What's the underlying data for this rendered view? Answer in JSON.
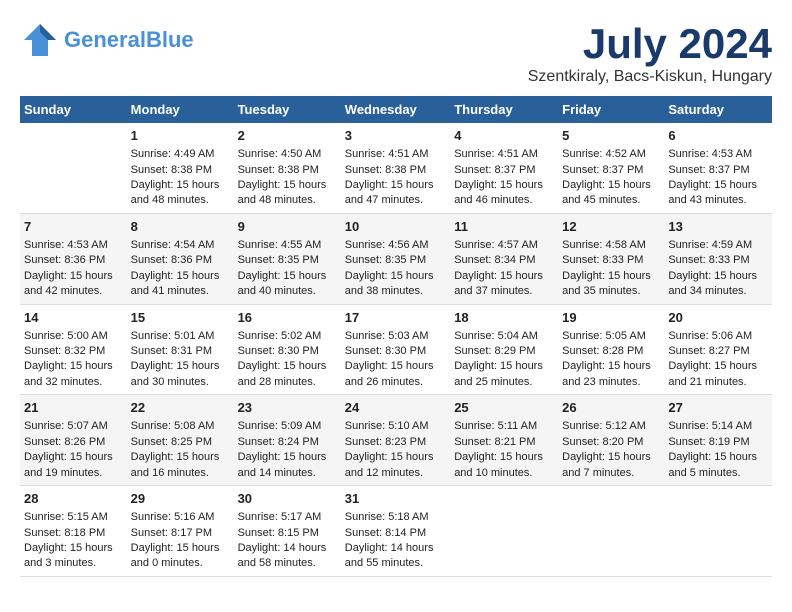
{
  "header": {
    "logo_line1": "General",
    "logo_line2": "Blue",
    "month_title": "July 2024",
    "location": "Szentkiraly, Bacs-Kiskun, Hungary"
  },
  "weekdays": [
    "Sunday",
    "Monday",
    "Tuesday",
    "Wednesday",
    "Thursday",
    "Friday",
    "Saturday"
  ],
  "weeks": [
    [
      {
        "day": "",
        "info": ""
      },
      {
        "day": "1",
        "info": "Sunrise: 4:49 AM\nSunset: 8:38 PM\nDaylight: 15 hours\nand 48 minutes."
      },
      {
        "day": "2",
        "info": "Sunrise: 4:50 AM\nSunset: 8:38 PM\nDaylight: 15 hours\nand 48 minutes."
      },
      {
        "day": "3",
        "info": "Sunrise: 4:51 AM\nSunset: 8:38 PM\nDaylight: 15 hours\nand 47 minutes."
      },
      {
        "day": "4",
        "info": "Sunrise: 4:51 AM\nSunset: 8:37 PM\nDaylight: 15 hours\nand 46 minutes."
      },
      {
        "day": "5",
        "info": "Sunrise: 4:52 AM\nSunset: 8:37 PM\nDaylight: 15 hours\nand 45 minutes."
      },
      {
        "day": "6",
        "info": "Sunrise: 4:53 AM\nSunset: 8:37 PM\nDaylight: 15 hours\nand 43 minutes."
      }
    ],
    [
      {
        "day": "7",
        "info": "Sunrise: 4:53 AM\nSunset: 8:36 PM\nDaylight: 15 hours\nand 42 minutes."
      },
      {
        "day": "8",
        "info": "Sunrise: 4:54 AM\nSunset: 8:36 PM\nDaylight: 15 hours\nand 41 minutes."
      },
      {
        "day": "9",
        "info": "Sunrise: 4:55 AM\nSunset: 8:35 PM\nDaylight: 15 hours\nand 40 minutes."
      },
      {
        "day": "10",
        "info": "Sunrise: 4:56 AM\nSunset: 8:35 PM\nDaylight: 15 hours\nand 38 minutes."
      },
      {
        "day": "11",
        "info": "Sunrise: 4:57 AM\nSunset: 8:34 PM\nDaylight: 15 hours\nand 37 minutes."
      },
      {
        "day": "12",
        "info": "Sunrise: 4:58 AM\nSunset: 8:33 PM\nDaylight: 15 hours\nand 35 minutes."
      },
      {
        "day": "13",
        "info": "Sunrise: 4:59 AM\nSunset: 8:33 PM\nDaylight: 15 hours\nand 34 minutes."
      }
    ],
    [
      {
        "day": "14",
        "info": "Sunrise: 5:00 AM\nSunset: 8:32 PM\nDaylight: 15 hours\nand 32 minutes."
      },
      {
        "day": "15",
        "info": "Sunrise: 5:01 AM\nSunset: 8:31 PM\nDaylight: 15 hours\nand 30 minutes."
      },
      {
        "day": "16",
        "info": "Sunrise: 5:02 AM\nSunset: 8:30 PM\nDaylight: 15 hours\nand 28 minutes."
      },
      {
        "day": "17",
        "info": "Sunrise: 5:03 AM\nSunset: 8:30 PM\nDaylight: 15 hours\nand 26 minutes."
      },
      {
        "day": "18",
        "info": "Sunrise: 5:04 AM\nSunset: 8:29 PM\nDaylight: 15 hours\nand 25 minutes."
      },
      {
        "day": "19",
        "info": "Sunrise: 5:05 AM\nSunset: 8:28 PM\nDaylight: 15 hours\nand 23 minutes."
      },
      {
        "day": "20",
        "info": "Sunrise: 5:06 AM\nSunset: 8:27 PM\nDaylight: 15 hours\nand 21 minutes."
      }
    ],
    [
      {
        "day": "21",
        "info": "Sunrise: 5:07 AM\nSunset: 8:26 PM\nDaylight: 15 hours\nand 19 minutes."
      },
      {
        "day": "22",
        "info": "Sunrise: 5:08 AM\nSunset: 8:25 PM\nDaylight: 15 hours\nand 16 minutes."
      },
      {
        "day": "23",
        "info": "Sunrise: 5:09 AM\nSunset: 8:24 PM\nDaylight: 15 hours\nand 14 minutes."
      },
      {
        "day": "24",
        "info": "Sunrise: 5:10 AM\nSunset: 8:23 PM\nDaylight: 15 hours\nand 12 minutes."
      },
      {
        "day": "25",
        "info": "Sunrise: 5:11 AM\nSunset: 8:21 PM\nDaylight: 15 hours\nand 10 minutes."
      },
      {
        "day": "26",
        "info": "Sunrise: 5:12 AM\nSunset: 8:20 PM\nDaylight: 15 hours\nand 7 minutes."
      },
      {
        "day": "27",
        "info": "Sunrise: 5:14 AM\nSunset: 8:19 PM\nDaylight: 15 hours\nand 5 minutes."
      }
    ],
    [
      {
        "day": "28",
        "info": "Sunrise: 5:15 AM\nSunset: 8:18 PM\nDaylight: 15 hours\nand 3 minutes."
      },
      {
        "day": "29",
        "info": "Sunrise: 5:16 AM\nSunset: 8:17 PM\nDaylight: 15 hours\nand 0 minutes."
      },
      {
        "day": "30",
        "info": "Sunrise: 5:17 AM\nSunset: 8:15 PM\nDaylight: 14 hours\nand 58 minutes."
      },
      {
        "day": "31",
        "info": "Sunrise: 5:18 AM\nSunset: 8:14 PM\nDaylight: 14 hours\nand 55 minutes."
      },
      {
        "day": "",
        "info": ""
      },
      {
        "day": "",
        "info": ""
      },
      {
        "day": "",
        "info": ""
      }
    ]
  ]
}
